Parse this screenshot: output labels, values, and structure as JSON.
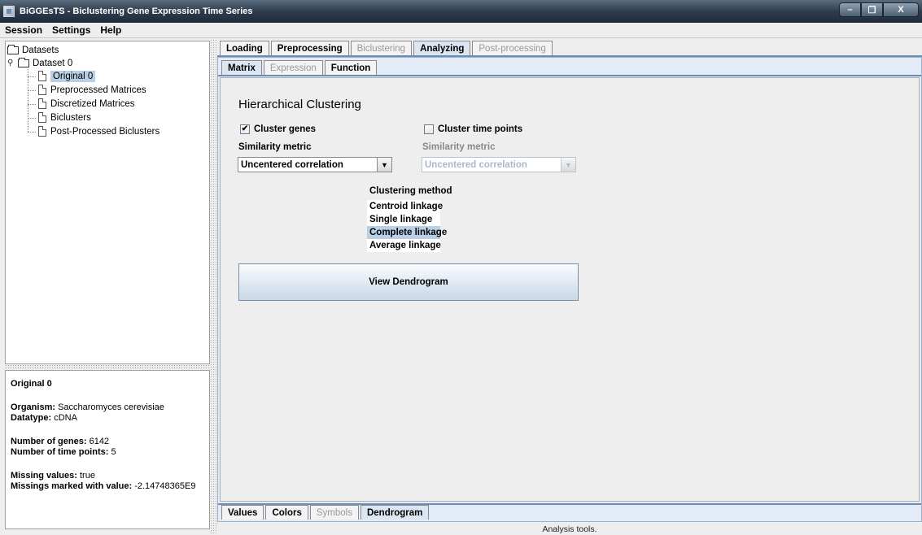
{
  "window": {
    "title": "BiGGEsTS - Biclustering Gene Expression Time Series",
    "buttons": [
      "–",
      "❐",
      "X"
    ]
  },
  "menu": [
    "Session",
    "Settings",
    "Help"
  ],
  "tree": {
    "root": "Datasets",
    "dataset": "Dataset 0",
    "items": [
      "Original 0",
      "Preprocessed Matrices",
      "Discretized Matrices",
      "Biclusters",
      "Post-Processed Biclusters"
    ]
  },
  "info": {
    "title": "Original 0",
    "organism_label": "Organism:",
    "organism": "Saccharomyces cerevisiae",
    "datatype_label": "Datatype:",
    "datatype": "cDNA",
    "genes_label": "Number of genes:",
    "genes": "6142",
    "timepoints_label": "Number of time points:",
    "timepoints": "5",
    "missing_label": "Missing values:",
    "missing": "true",
    "marked_label": "Missings marked with value:",
    "marked": "-2.14748365E9"
  },
  "top_tabs": [
    "Loading",
    "Preprocessing",
    "Biclustering",
    "Analyzing",
    "Post-processing"
  ],
  "sub_tabs": [
    "Matrix",
    "Expression",
    "Function"
  ],
  "bottom_tabs": [
    "Values",
    "Colors",
    "Symbols",
    "Dendrogram"
  ],
  "clustering": {
    "title": "Hierarchical Clustering",
    "cluster_genes": "Cluster genes",
    "cluster_genes_checked": true,
    "cluster_time_points": "Cluster time points",
    "cluster_time_points_checked": false,
    "similarity_label": "Similarity metric",
    "similarity_value": "Uncentered correlation",
    "similarity_label_2": "Similarity metric",
    "similarity_value_2": "Uncentered correlation",
    "method_label": "Clustering method",
    "methods": [
      "Centroid linkage",
      "Single linkage",
      "Complete linkage",
      "Average linkage"
    ],
    "selected_method": "Complete linkage",
    "view_button": "View Dendrogram"
  },
  "status": "Analysis tools."
}
